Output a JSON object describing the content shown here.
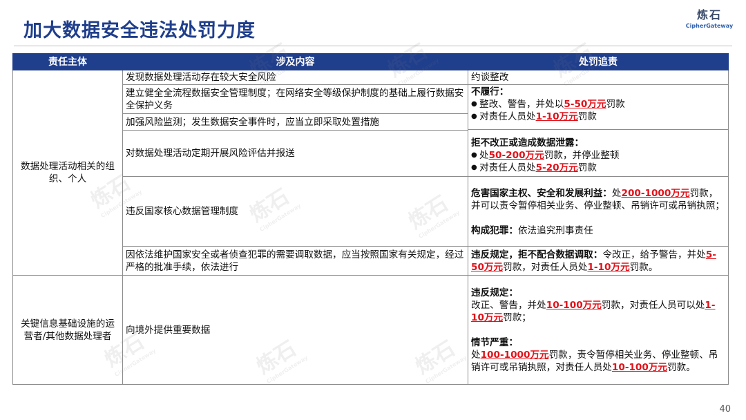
{
  "slide": {
    "title": "加大数据安全违法处罚力度",
    "page_number": "40"
  },
  "logo": {
    "cn": "炼石",
    "en": "CipherGateway"
  },
  "table": {
    "headers": [
      "责任主体",
      "涉及内容",
      "处罚追责"
    ],
    "entity1": "数据处理活动相关的组织、个人",
    "entity2": "关键信息基础设施的运营者/其他数据处理者",
    "content": [
      "发现数据处理活动存在较大安全风险",
      "建立健全全流程数据安全管理制度；在网络安全等级保护制度的基础上履行数据安全保护义务",
      "加强风险监测；发生数据安全事件时，应当立即采取处置措施",
      "对数据处理活动定期开展风险评估并报送",
      "违反国家核心数据管理制度",
      "因依法维护国家安全或者侦查犯罪的需要调取数据，应当按照国家有关规定，经过严格的批准手续，依法进行",
      "向境外提供重要数据"
    ],
    "p1": "约谈整改",
    "p2": {
      "head": "不履行：",
      "b1_pre": "整改、警告，并处以",
      "b1_red": "5-50万元",
      "b1_post": "罚款",
      "b2_pre": "对责任人员处",
      "b2_red": "1-10万元",
      "b2_post": "罚款",
      "head2": "拒不改正或造成数据泄露：",
      "c1_pre": "处",
      "c1_red": "50-200万元",
      "c1_post": "罚款，并停业整顿",
      "c2_pre": "对责任人员处",
      "c2_red": "5-20万元",
      "c2_post": "罚款"
    },
    "p3": {
      "head": "危害国家主权、安全和发展利益：",
      "pre": "处",
      "red": "200-1000万元",
      "post": "罚款，并可以责令暂停相关业务、停业整顿、吊销许可或吊销执照；",
      "crime_head": "构成犯罪：",
      "crime_text": "依法追究刑事责任"
    },
    "p4": {
      "head": "违反规定，拒不配合数据调取：",
      "text1": "令改正，给予警告，并处",
      "red1": "5-50万元",
      "text2": "罚款，对责任人员处",
      "red2": "1-10万元",
      "text3": "罚款。"
    },
    "p5": {
      "head": "违反规定：",
      "t1": "改正、警告，并处",
      "r1": "10-100万元",
      "t2": "罚款，对责任人员可以处",
      "r2": "1-10万元",
      "t3": "罚款；",
      "head2": "情节严重：",
      "u1": "处",
      "s1": "100-1000万元",
      "u2": "罚款，责令暂停相关业务、停业整顿、吊销许可或吊销执照，对责任人员处",
      "s2": "10-100万元",
      "u3": "罚款。"
    }
  }
}
